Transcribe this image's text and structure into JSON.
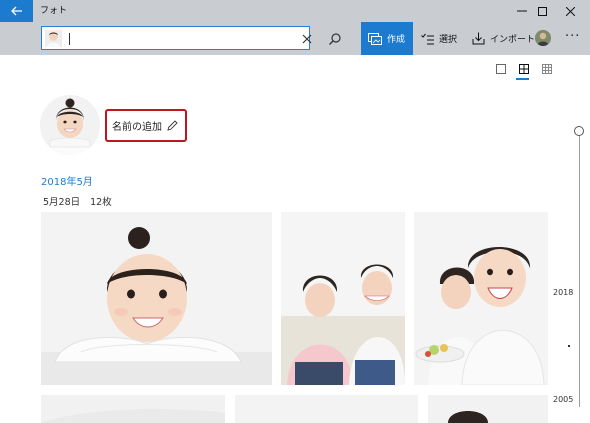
{
  "window": {
    "title": "フォト"
  },
  "search": {
    "value": "",
    "placeholder": ""
  },
  "toolbar": {
    "create_label": "作成",
    "select_label": "選択",
    "import_label": "インポート",
    "more_label": "···"
  },
  "person": {
    "add_name_label": "名前の追加"
  },
  "group": {
    "month": "2018年5月",
    "date": "5月28日",
    "count": "12枚"
  },
  "timeline": {
    "top_year": "2018",
    "bottom_year": "2005"
  },
  "icons": {
    "back": "back-arrow-icon",
    "minimize": "minimize-icon",
    "maximize": "maximize-icon",
    "close": "close-icon",
    "clear": "clear-x-icon",
    "search": "search-icon",
    "create": "create-icon",
    "select": "select-icon",
    "import": "import-icon",
    "edit": "pencil-icon"
  },
  "colors": {
    "accent": "#1d7bcf",
    "titlebar": "#c9cdd2",
    "highlight": "#c0141f"
  }
}
